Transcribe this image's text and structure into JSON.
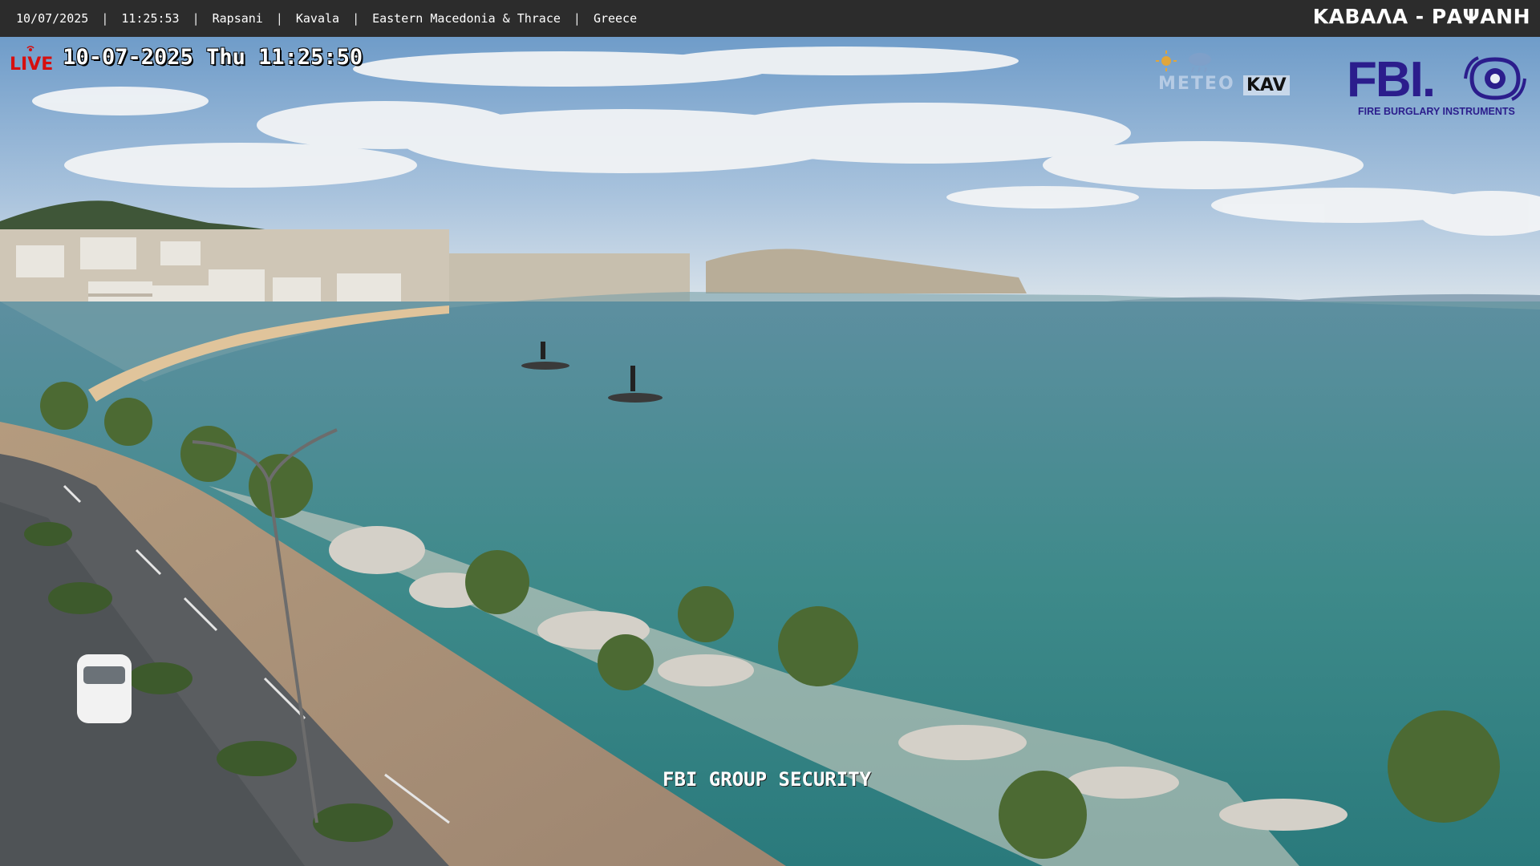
{
  "topbar": {
    "date": "10/07/2025",
    "time": "11:25:53",
    "village": "Rapsani",
    "city": "Kavala",
    "region": "Eastern Macedonia & Thrace",
    "country": "Greece",
    "separator": "|",
    "camera_title": "ΚΑΒΑΛΑ - ΡΑΨΑΝΗ"
  },
  "overlay": {
    "live_label": "LIVE",
    "timestamp": "10-07-2025 Thu 11:25:50",
    "meteo_label": "METEO",
    "kav_label": "KAV",
    "brand": "FBI.",
    "brand_subtitle": "FIRE BURGLARY INSTRUMENTS",
    "watermark": "FBI GROUP SECURITY"
  },
  "colors": {
    "topbar_bg": "#2c2c2c",
    "live_red": "#d60f0f",
    "brand_purple": "#2b1d8c",
    "sea": "#3f8a88",
    "sky": "#7fa6cc"
  },
  "icons": [
    "live-signal-icon",
    "sun-icon",
    "cloud-rain-icon",
    "fbi-eye-icon"
  ]
}
